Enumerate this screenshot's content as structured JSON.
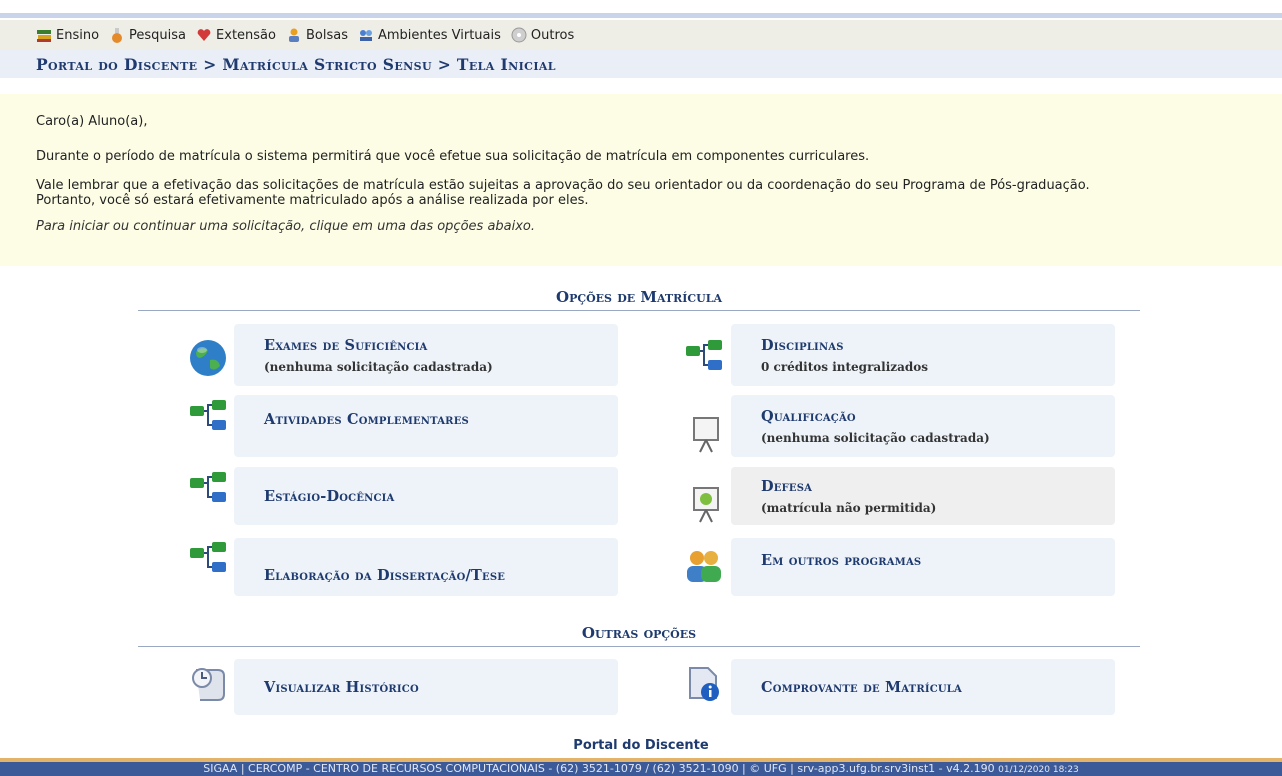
{
  "menu": [
    {
      "label": "Ensino",
      "icon": "books-icon"
    },
    {
      "label": "Pesquisa",
      "icon": "flask-icon"
    },
    {
      "label": "Extensão",
      "icon": "heart-icon"
    },
    {
      "label": "Bolsas",
      "icon": "person-icon"
    },
    {
      "label": "Ambientes Virtuais",
      "icon": "virtual-icon"
    },
    {
      "label": "Outros",
      "icon": "cd-icon"
    }
  ],
  "breadcrumb": "Portal do Discente > Matrícula Stricto Sensu > Tela Inicial",
  "intro": {
    "greeting": "Caro(a) Aluno(a),",
    "p1": "Durante o período de matrícula o sistema permitirá que você efetue sua solicitação de matrícula em componentes curriculares.",
    "p2a": "Vale lembrar que a efetivação das solicitações de matrícula estão sujeitas a aprovação do seu orientador ou da coordenação do seu Programa de Pós-graduação.",
    "p2b": "Portanto, você só estará efetivamente matriculado após a análise realizada por eles.",
    "hint": "Para iniciar ou continuar uma solicitação, clique em uma das opções abaixo."
  },
  "sections": {
    "matricula": "Opções de Matrícula",
    "outras": "Outras opções"
  },
  "cards": {
    "exames": {
      "title": "Exames de Suficiência",
      "sub": "(nenhuma solicitação cadastrada)"
    },
    "disciplinas": {
      "title": "Disciplinas",
      "sub": "0 créditos integralizados"
    },
    "atividades": {
      "title": "Atividades Complementares"
    },
    "qualificacao": {
      "title": "Qualificação",
      "sub": "(nenhuma solicitação cadastrada)"
    },
    "estagio": {
      "title": "Estágio-Docência"
    },
    "defesa": {
      "title": "Defesa",
      "sub": "(matrícula não permitida)"
    },
    "elaboracao": {
      "title": "Elaboração da Dissertação/Tese"
    },
    "outros_programas": {
      "title": "Em outros programas"
    },
    "historico": {
      "title": "Visualizar Histórico"
    },
    "comprovante": {
      "title": "Comprovante de Matrícula"
    }
  },
  "footer": {
    "label": "Portal do Discente",
    "text": "SIGAA | CERCOMP - CENTRO DE RECURSOS COMPUTACIONAIS - (62) 3521-1079 / (62) 3521-1090 | © UFG | srv-app3.ufg.br.srv3inst1 - v4.2.190",
    "date": "01/12/2020 18:23"
  }
}
